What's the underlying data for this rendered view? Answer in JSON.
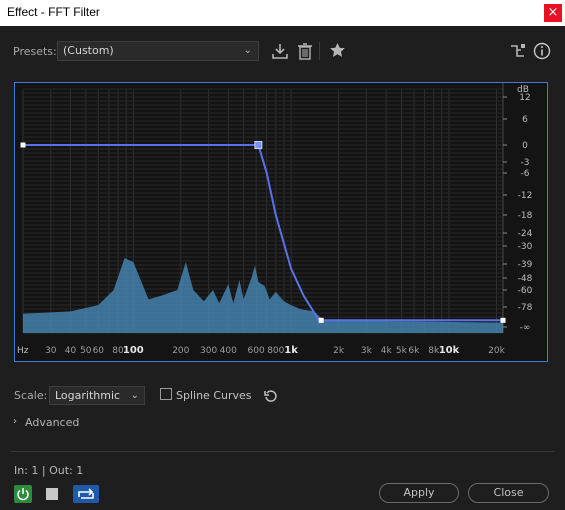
{
  "window": {
    "title": "Effect - FFT Filter",
    "close_glyph": "×"
  },
  "presets": {
    "label": "Presets:",
    "value": "(Custom)"
  },
  "toolbar_icons": [
    "download-preset-icon",
    "trash-icon",
    "star-icon",
    "routing-icon",
    "info-icon"
  ],
  "graph": {
    "db_unit": "dB",
    "db_ticks": [
      "12",
      "6",
      "0",
      "-3",
      "-6",
      "-12",
      "-18",
      "-24",
      "-30",
      "-39",
      "-48",
      "-60",
      "-78",
      "-∞"
    ],
    "freq_unit": "Hz",
    "freq_ticks": [
      "30",
      "40",
      "50",
      "60",
      "80",
      "100",
      "200",
      "300",
      "400",
      "600",
      "800",
      "1k",
      "2k",
      "3k",
      "4k",
      "5k",
      "6k",
      "8k",
      "10k",
      "20k"
    ],
    "curve_color": "#5a72e8",
    "spectrum_color": "#4a8fc0"
  },
  "chart_data": {
    "type": "line",
    "title": "",
    "xlabel": "Hz",
    "ylabel": "dB",
    "x_scale": "log",
    "xlim": [
      20,
      22000
    ],
    "ylim": [
      -96,
      18
    ],
    "series": [
      {
        "values": [
          [
            20,
            0
          ],
          [
            620,
            0
          ],
          [
            700,
            -6
          ],
          [
            800,
            -18
          ],
          [
            1000,
            -42
          ],
          [
            1200,
            -66
          ],
          [
            1500,
            -90
          ],
          [
            22000,
            -90
          ]
        ]
      }
    ],
    "control_points": [
      [
        20,
        0
      ],
      [
        620,
        0
      ],
      [
        1550,
        -90
      ],
      [
        22000,
        -90
      ]
    ]
  },
  "scale": {
    "label": "Scale:",
    "value": "Logarithmic"
  },
  "spline": {
    "label": "Spline Curves",
    "checked": false
  },
  "advanced": {
    "label": "Advanced"
  },
  "io": {
    "text": "In: 1 | Out: 1"
  },
  "buttons": {
    "apply": "Apply",
    "close": "Close"
  },
  "colors": {
    "accent": "#2e8de0",
    "power": "#2e8a3e",
    "graph_border": "#3e7ad6"
  }
}
